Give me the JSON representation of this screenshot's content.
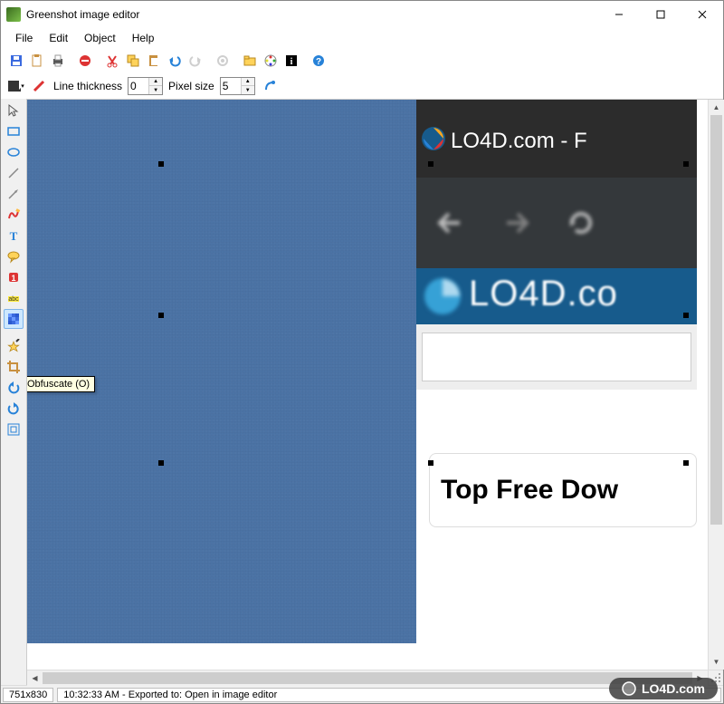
{
  "window": {
    "title": "Greenshot image editor",
    "controls": {
      "minimize": "—",
      "maximize": "▢",
      "close": "✕"
    }
  },
  "menubar": [
    "File",
    "Edit",
    "Object",
    "Help"
  ],
  "toolbar_icons": [
    "save-icon",
    "copy-icon",
    "print-icon",
    "sep",
    "delete-icon",
    "sep",
    "cut-icon",
    "duplicate-icon",
    "paste-icon",
    "undo-icon",
    "redo-icon",
    "sep",
    "settings-icon",
    "sep",
    "open-folder-icon",
    "color-picker-icon",
    "info-icon",
    "sep",
    "help-icon"
  ],
  "propbar": {
    "obfuscate_icon": "obfuscate-icon",
    "highlight_icon": "highlight-icon",
    "line_thickness_label": "Line thickness",
    "line_thickness_value": "0",
    "pixel_size_label": "Pixel size",
    "pixel_size_value": "5",
    "magnify_icon": "effects-icon"
  },
  "sidetools": [
    {
      "name": "cursor-tool",
      "label": "Selection Tool (ESC)"
    },
    {
      "name": "rectangle-tool",
      "label": "Draw rectangle (R)"
    },
    {
      "name": "ellipse-tool",
      "label": "Draw ellipse (E)"
    },
    {
      "name": "line-tool",
      "label": "Draw line (L)"
    },
    {
      "name": "arrow-tool",
      "label": "Draw arrow (A)"
    },
    {
      "name": "freehand-tool",
      "label": "Draw freehand (F)"
    },
    {
      "name": "text-tool",
      "label": "Add textbox (T)"
    },
    {
      "name": "speech-tool",
      "label": "Add speechbubble (S)"
    },
    {
      "name": "counter-tool",
      "label": "Add counter"
    },
    {
      "name": "highlight-tool",
      "label": "Highlight (H)"
    },
    {
      "name": "obfuscate-tool",
      "label": "Obfuscate (O)",
      "active": true
    },
    {
      "name": "effects-tool",
      "label": "Effects"
    },
    {
      "name": "crop-tool",
      "label": "Crop (C)"
    },
    {
      "name": "rotate-left-tool",
      "label": "Rotate counter clockwise"
    },
    {
      "name": "rotate-right-tool",
      "label": "Rotate clockwise"
    },
    {
      "name": "resize-tool",
      "label": "Resize"
    }
  ],
  "tooltip": "Obfuscate (O)",
  "canvas_content": {
    "browser_title_text": "LO4D.com - F",
    "banner_text": "LO4D.co",
    "card_text": "Top Free Dow"
  },
  "status": {
    "dimensions": "751x830",
    "message": "10:32:33 AM - Exported to: Open in image editor"
  },
  "watermark": "LO4D.com"
}
